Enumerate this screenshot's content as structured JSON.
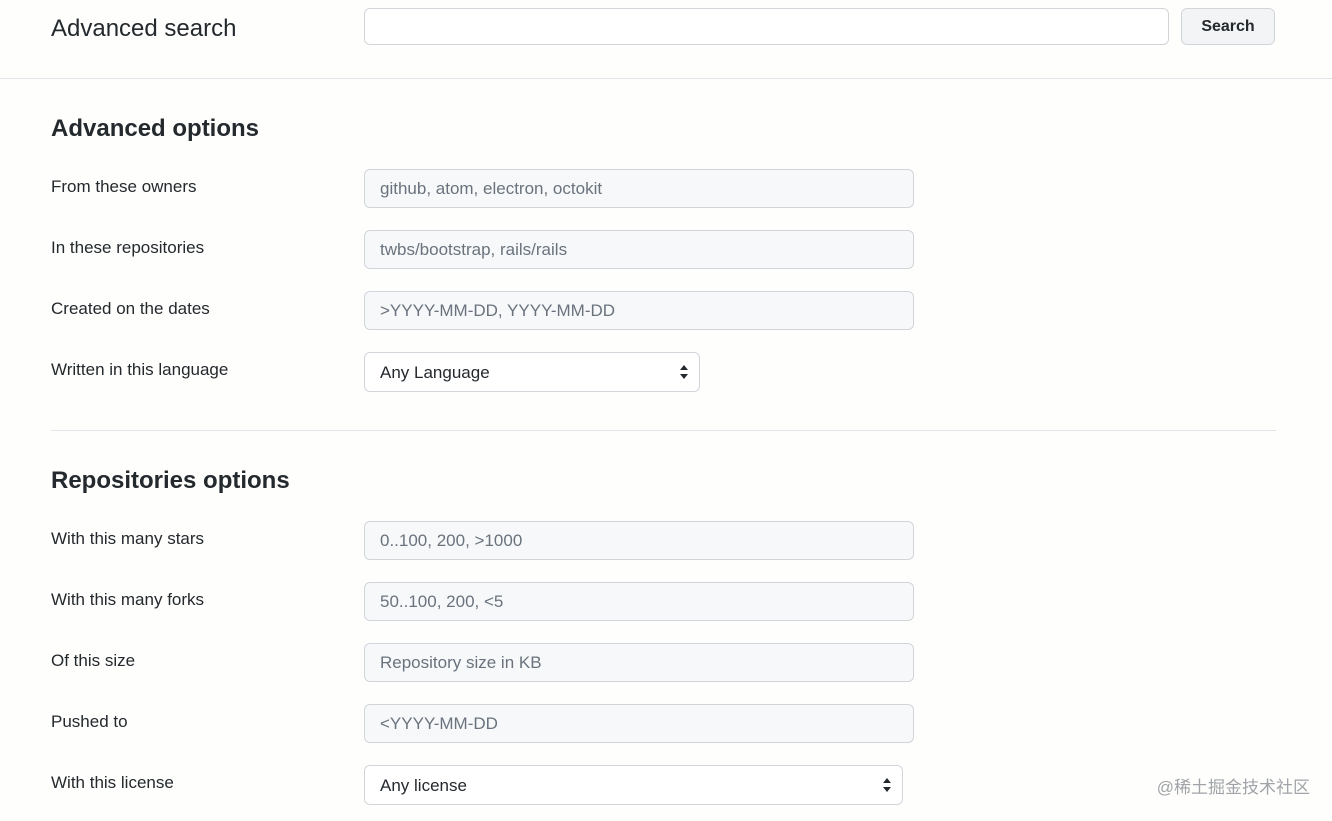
{
  "header": {
    "title": "Advanced search",
    "search_value": "",
    "search_button_label": "Search"
  },
  "advanced_options": {
    "title": "Advanced options",
    "fields": [
      {
        "label": "From these owners",
        "placeholder": "github, atom, electron, octokit"
      },
      {
        "label": "In these repositories",
        "placeholder": "twbs/bootstrap, rails/rails"
      },
      {
        "label": "Created on the dates",
        "placeholder": ">YYYY-MM-DD, YYYY-MM-DD"
      }
    ],
    "language": {
      "label": "Written in this language",
      "selected": "Any Language"
    }
  },
  "repositories_options": {
    "title": "Repositories options",
    "fields": [
      {
        "label": "With this many stars",
        "placeholder": "0..100, 200, >1000"
      },
      {
        "label": "With this many forks",
        "placeholder": "50..100, 200, <5"
      },
      {
        "label": "Of this size",
        "placeholder": "Repository size in KB"
      },
      {
        "label": "Pushed to",
        "placeholder": "<YYYY-MM-DD"
      }
    ],
    "license": {
      "label": "With this license",
      "selected": "Any license"
    }
  },
  "watermark": "@稀土掘金技术社区",
  "icons": {
    "select_arrow": "select-arrows-icon"
  }
}
